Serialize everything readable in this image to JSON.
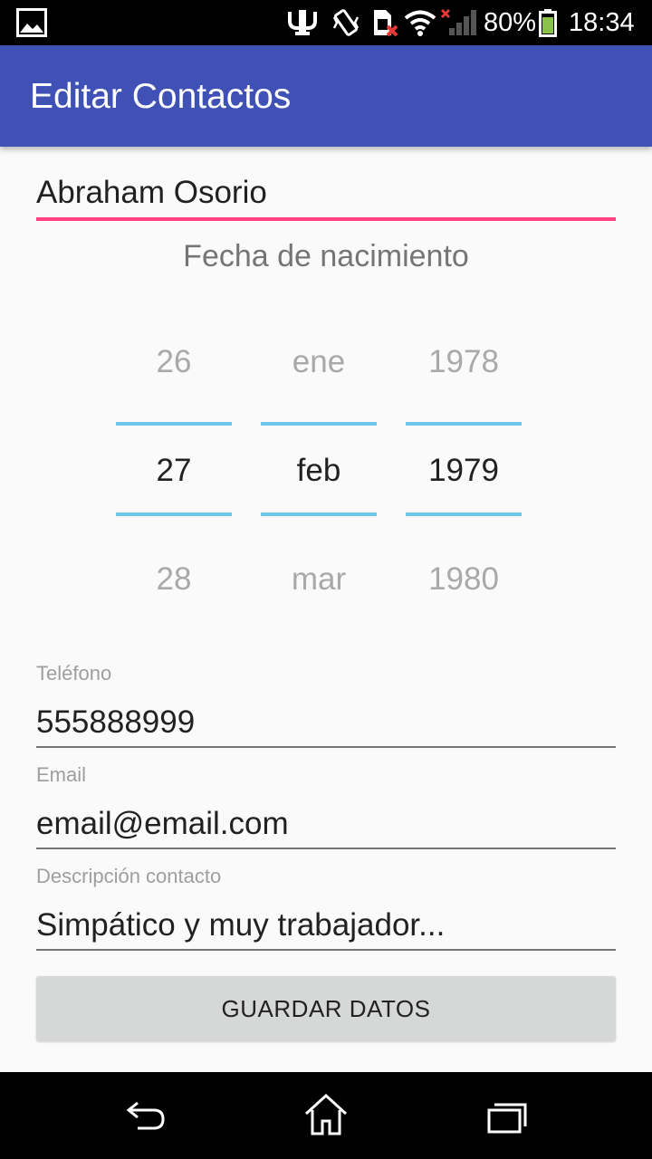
{
  "status_bar": {
    "battery_percent": "80%",
    "time": "18:34",
    "icons": [
      "image-icon",
      "usb-icon",
      "vibrate-icon",
      "sim-icon",
      "wifi-icon",
      "signal-icon",
      "battery-icon"
    ]
  },
  "app_bar": {
    "title": "Editar Contactos"
  },
  "form": {
    "name_value": "Abraham Osorio",
    "birth_label": "Fecha de nacimiento",
    "date_picker": {
      "day": {
        "prev": "26",
        "current": "27",
        "next": "28"
      },
      "month": {
        "prev": "ene",
        "current": "feb",
        "next": "mar"
      },
      "year": {
        "prev": "1978",
        "current": "1979",
        "next": "1980"
      }
    },
    "phone": {
      "label": "Teléfono",
      "value": "555888999"
    },
    "email": {
      "label": "Email",
      "value": "email@email.com"
    },
    "description": {
      "label": "Descripción contacto",
      "value": "Simpático y muy trabajador..."
    },
    "save_button": "GUARDAR DATOS"
  },
  "nav_bar": {
    "icons": [
      "back-icon",
      "home-icon",
      "recent-apps-icon"
    ]
  },
  "colors": {
    "app_bar": "#3f51b5",
    "accent": "#ff4081",
    "picker_divider": "#6ec6ea",
    "button": "#d6d7d7"
  }
}
